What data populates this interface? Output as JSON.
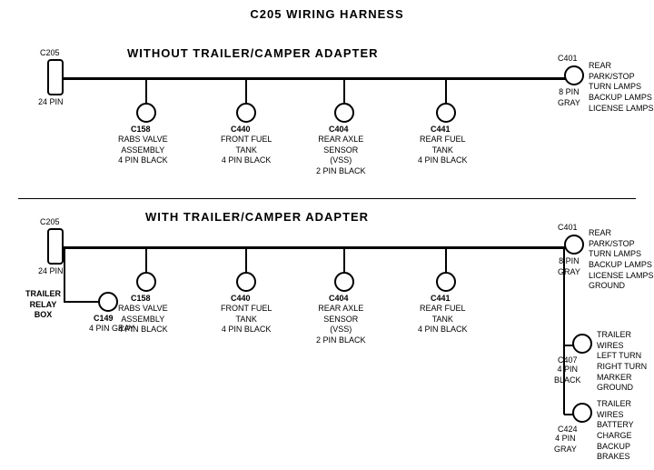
{
  "title": "C205 WIRING HARNESS",
  "top_section": {
    "label": "WITHOUT TRAILER/CAMPER ADAPTER",
    "left_connector": {
      "id": "C205",
      "sub": "24 PIN"
    },
    "right_connector": {
      "id": "C401",
      "sub": "8 PIN\nGRAY",
      "description": "REAR PARK/STOP\nTURN LAMPS\nBACKUP LAMPS\nLICENSE LAMPS"
    },
    "connectors": [
      {
        "id": "C158",
        "label": "RABS VALVE\nASSEMBLY\n4 PIN BLACK"
      },
      {
        "id": "C440",
        "label": "FRONT FUEL\nTANK\n4 PIN BLACK"
      },
      {
        "id": "C404",
        "label": "REAR AXLE\nSENSOR\n(VSS)\n2 PIN BLACK"
      },
      {
        "id": "C441",
        "label": "REAR FUEL\nTANK\n4 PIN BLACK"
      }
    ]
  },
  "bottom_section": {
    "label": "WITH TRAILER/CAMPER ADAPTER",
    "left_connector": {
      "id": "C205",
      "sub": "24 PIN"
    },
    "trailer_relay": {
      "label": "TRAILER\nRELAY\nBOX"
    },
    "c149": {
      "id": "C149",
      "sub": "4 PIN GRAY"
    },
    "right_connector": {
      "id": "C401",
      "sub": "8 PIN\nGRAY",
      "description": "REAR PARK/STOP\nTURN LAMPS\nBACKUP LAMPS\nLICENSE LAMPS\nGROUND"
    },
    "connectors": [
      {
        "id": "C158",
        "label": "RABS VALVE\nASSEMBLY\n4 PIN BLACK"
      },
      {
        "id": "C440",
        "label": "FRONT FUEL\nTANK\n4 PIN BLACK"
      },
      {
        "id": "C404",
        "label": "REAR AXLE\nSENSOR\n(VSS)\n2 PIN BLACK"
      },
      {
        "id": "C441",
        "label": "REAR FUEL\nTANK\n4 PIN BLACK"
      }
    ],
    "c407": {
      "id": "C407",
      "sub": "4 PIN\nBLACK",
      "description": "TRAILER WIRES\nLEFT TURN\nRIGHT TURN\nMARKER\nGROUND"
    },
    "c424": {
      "id": "C424",
      "sub": "4 PIN\nGRAY",
      "description": "TRAILER WIRES\nBATTERY CHARGE\nBACKUP\nBRAKES"
    }
  }
}
